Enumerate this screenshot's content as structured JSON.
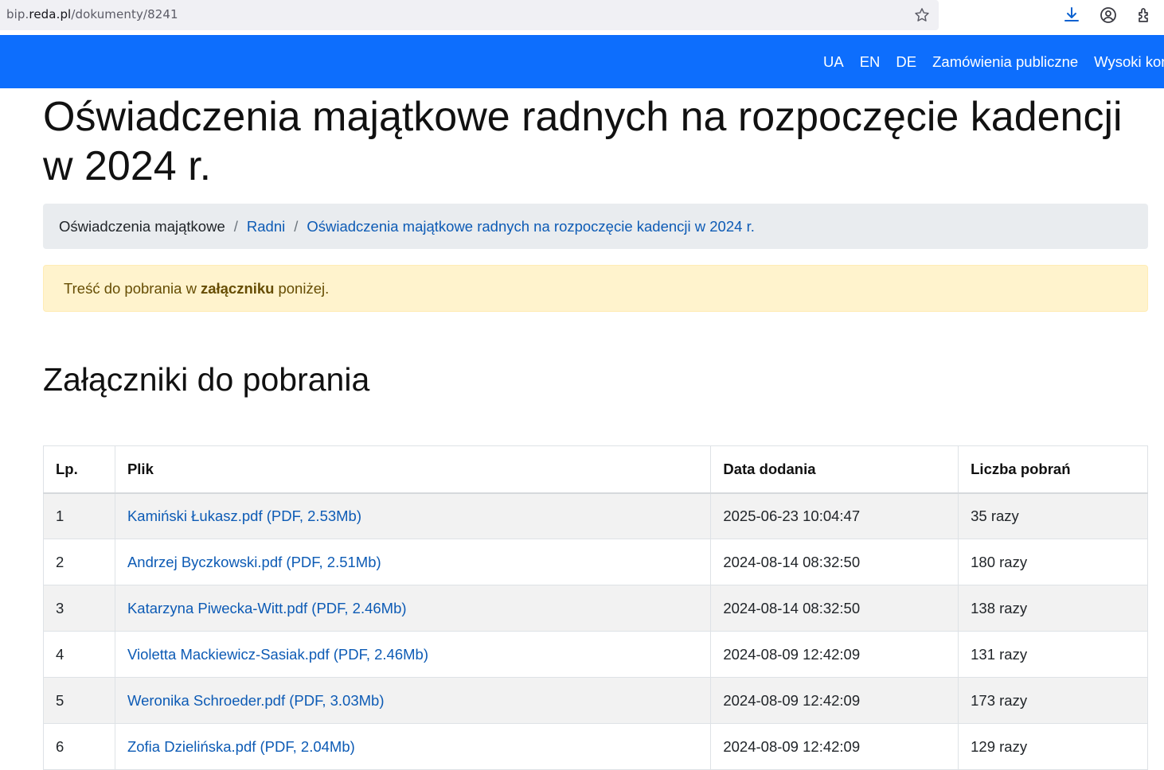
{
  "browser": {
    "url_prefix": "bip.",
    "url_domain": "reda.pl",
    "url_path": "/dokumenty/8241",
    "icons": [
      "star-icon",
      "download-icon",
      "account-icon",
      "extensions-icon"
    ]
  },
  "navbar": {
    "links": [
      {
        "label": "UA"
      },
      {
        "label": "EN"
      },
      {
        "label": "DE"
      },
      {
        "label": "Zamówienia publiczne"
      },
      {
        "label": "Wysoki kont"
      }
    ],
    "bg_color": "#0d6efd"
  },
  "page_title": "Oświadczenia majątkowe radnych na rozpoczęcie kadencji w 2024 r.",
  "breadcrumb": {
    "items": [
      {
        "label": "Oświadczenia majątkowe"
      },
      {
        "label": "Radni"
      },
      {
        "label": "Oświadczenia majątkowe radnych na rozpoczęcie kadencji w 2024 r."
      }
    ],
    "separator": "/"
  },
  "alert": {
    "before": "Treść do pobrania w",
    "bold": "załączniku",
    "after": "poniżej."
  },
  "attachments": {
    "title": "Załączniki do pobrania",
    "headers": [
      "Lp.",
      "Plik",
      "Data dodania",
      "Liczba pobrań"
    ],
    "rows": [
      {
        "lp": "1",
        "file": "Kamiński Łukasz.pdf (PDF, 2.53Mb)",
        "date": "2025-06-23 10:04:47",
        "count": "35 razy"
      },
      {
        "lp": "2",
        "file": "Andrzej Byczkowski.pdf (PDF, 2.51Mb)",
        "date": "2024-08-14 08:32:50",
        "count": "180 razy"
      },
      {
        "lp": "3",
        "file": "Katarzyna Piwecka-Witt.pdf (PDF, 2.46Mb)",
        "date": "2024-08-14 08:32:50",
        "count": "138 razy"
      },
      {
        "lp": "4",
        "file": "Violetta Mackiewicz-Sasiak.pdf (PDF, 2.46Mb)",
        "date": "2024-08-09 12:42:09",
        "count": "131 razy"
      },
      {
        "lp": "5",
        "file": "Weronika Schroeder.pdf (PDF, 3.03Mb)",
        "date": "2024-08-09 12:42:09",
        "count": "173 razy"
      },
      {
        "lp": "6",
        "file": "Zofia Dzielińska.pdf (PDF, 2.04Mb)",
        "date": "2024-08-09 12:42:09",
        "count": "129 razy"
      }
    ]
  }
}
